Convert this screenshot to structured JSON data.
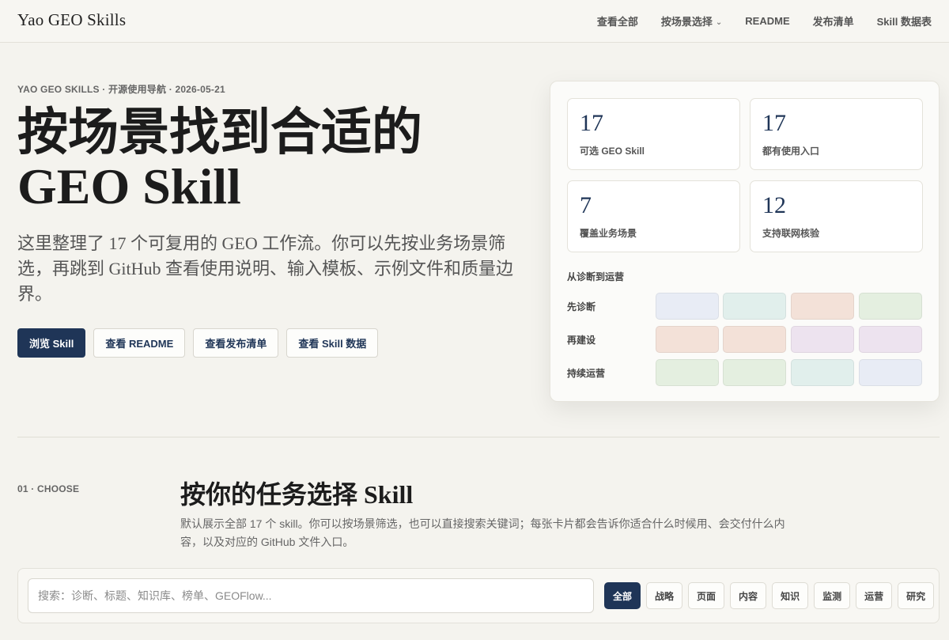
{
  "header": {
    "brand": "Yao GEO Skills",
    "nav": [
      "查看全部",
      "按场景选择",
      "README",
      "发布清单",
      "Skill 数据表"
    ]
  },
  "hero": {
    "eyebrow": "YAO GEO SKILLS · 开源使用导航 · 2026-05-21",
    "title_line1": "按场景找到合适的",
    "title_line2": "GEO Skill",
    "description": "这里整理了 17 个可复用的 GEO 工作流。你可以先按业务场景筛选，再跳到 GitHub 查看使用说明、输入模板、示例文件和质量边界。",
    "buttons": [
      "浏览 Skill",
      "查看 README",
      "查看发布清单",
      "查看 Skill 数据"
    ]
  },
  "panel": {
    "stats": [
      {
        "value": "17",
        "label": "可选 GEO Skill"
      },
      {
        "value": "17",
        "label": "都有使用入口"
      },
      {
        "value": "7",
        "label": "覆盖业务场景"
      },
      {
        "value": "12",
        "label": "支持联网核验"
      }
    ],
    "flow_title": "从诊断到运营",
    "flow_rows": [
      {
        "label": "先诊断",
        "colors": [
          "#e8ecf5",
          "#e1efec",
          "#f3e1d8",
          "#e4efe0"
        ]
      },
      {
        "label": "再建设",
        "colors": [
          "#f3e1d8",
          "#f3e1d8",
          "#ede3ef",
          "#ede3ef"
        ]
      },
      {
        "label": "持续运营",
        "colors": [
          "#e4efe0",
          "#e4efe0",
          "#e1efec",
          "#e8ecf5"
        ]
      }
    ]
  },
  "section": {
    "number": "01 · CHOOSE",
    "title": "按你的任务选择 Skill",
    "description": "默认展示全部 17 个 skill。你可以按场景筛选，也可以直接搜索关键词；每张卡片都会告诉你适合什么时候用、会交付什么内容，以及对应的 GitHub 文件入口。"
  },
  "filter": {
    "search_placeholder": "搜索：诊断、标题、知识库、榜单、GEOFlow...",
    "options": [
      "全部",
      "战略",
      "页面",
      "内容",
      "知识",
      "监测",
      "运营",
      "研究"
    ],
    "active": "全部"
  },
  "colors": {
    "accent": "#1f3557",
    "background": "#f4f3ee"
  }
}
